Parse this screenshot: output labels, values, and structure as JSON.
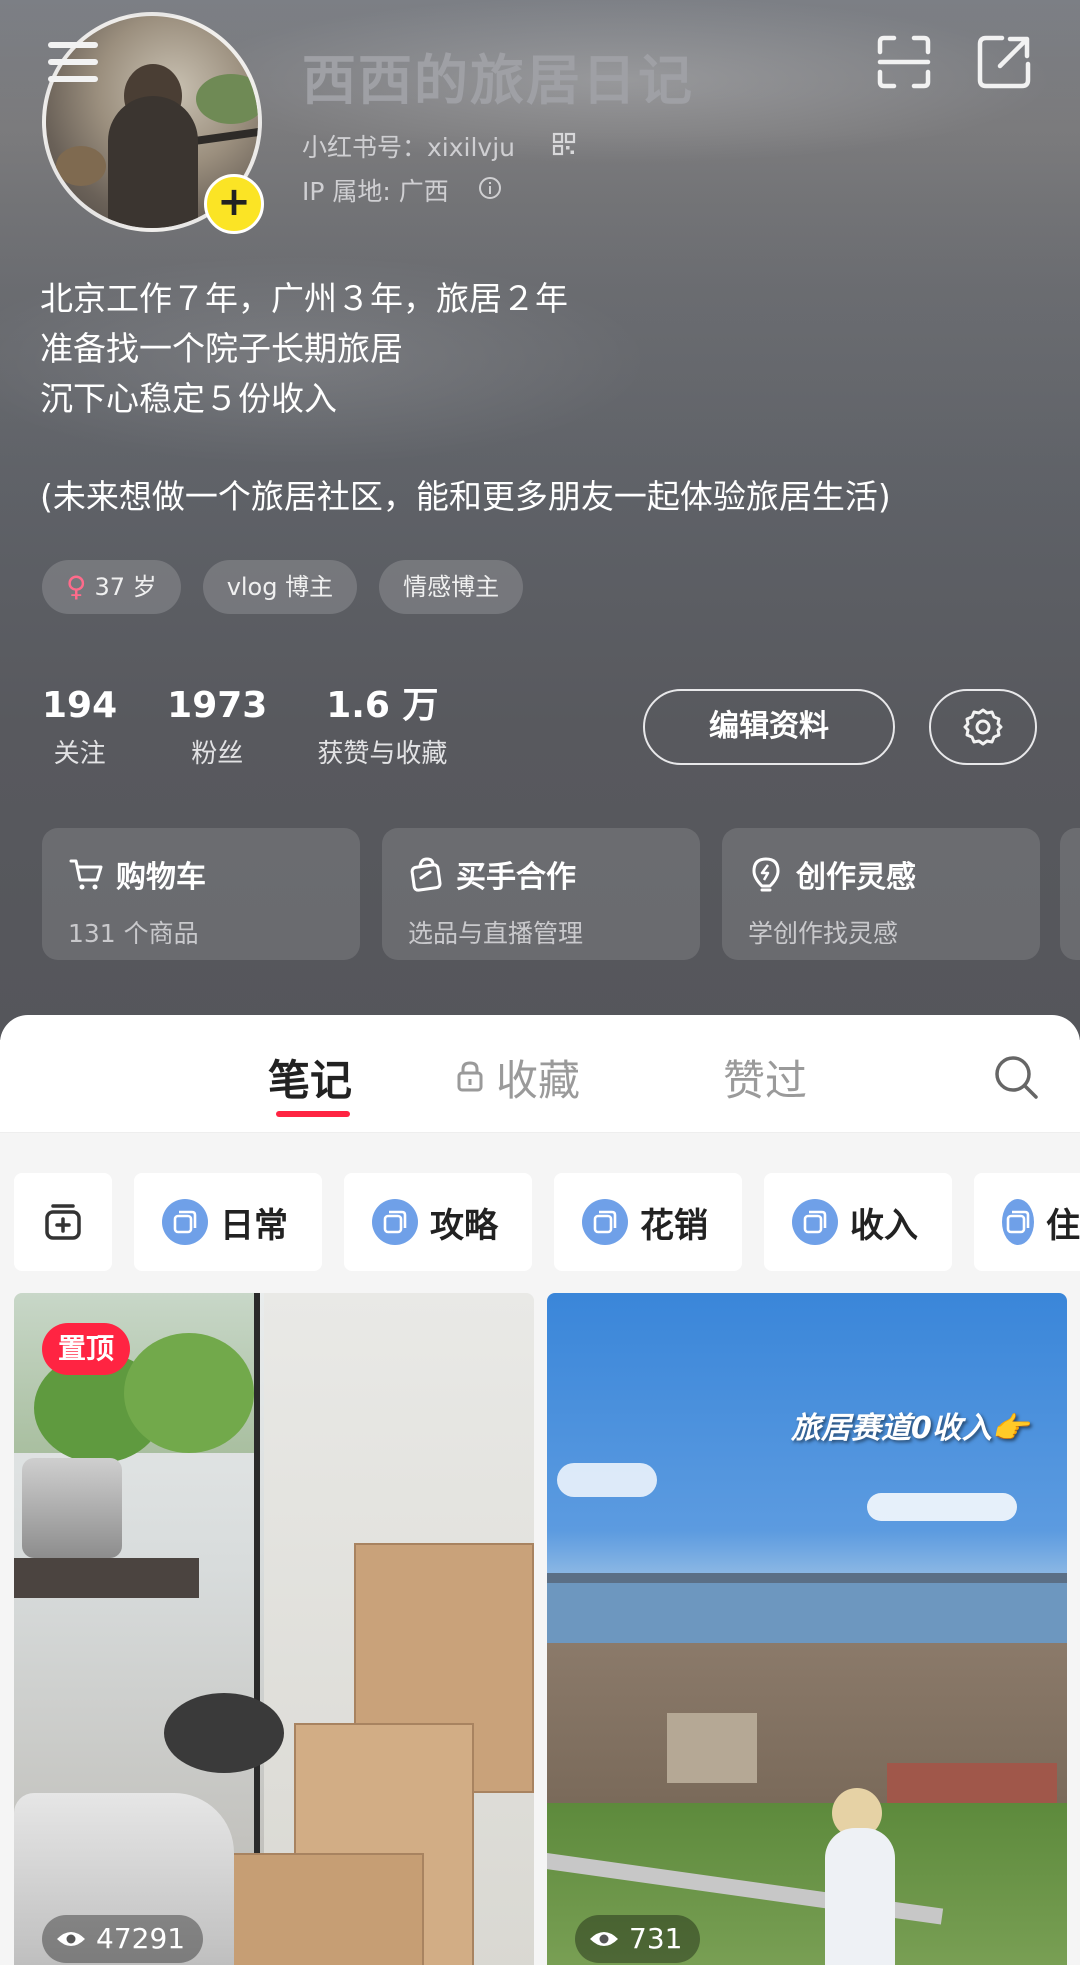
{
  "profile": {
    "nickname": "西西的旅居日记",
    "red_id": "小红书号：xixilvju",
    "ip": "IP 属地: 广西",
    "bio": [
      "北京工作７年，广州３年，旅居２年",
      "准备找一个院子长期旅居",
      "沉下心稳定５份收入",
      "(未来想做一个旅居社区，能和更多朋友一起体验旅居生活)"
    ],
    "tags": [
      {
        "icon": "female-icon",
        "label": "37 岁"
      },
      {
        "label": "vlog 博主"
      },
      {
        "label": "情感博主"
      }
    ]
  },
  "stats": [
    {
      "value": "194",
      "label": "关注"
    },
    {
      "value": "1973",
      "label": "粉丝"
    },
    {
      "value": "1.6 万",
      "label": "获赞与收藏"
    }
  ],
  "actions": {
    "edit_label": "编辑资料"
  },
  "cards": [
    {
      "icon": "cart-icon",
      "title": "购物车",
      "subtitle": "131 个商品"
    },
    {
      "icon": "bag-icon",
      "title": "买手合作",
      "subtitle": "选品与直播管理"
    },
    {
      "icon": "bulb-icon",
      "title": "创作灵感",
      "subtitle": "学创作找灵感"
    }
  ],
  "tabs": [
    {
      "label": "笔记",
      "active": true
    },
    {
      "label": "收藏",
      "locked": true
    },
    {
      "label": "赞过"
    }
  ],
  "filters": [
    "日常",
    "攻略",
    "花销",
    "收入",
    "住"
  ],
  "posts": [
    {
      "pinned_label": "置顶",
      "views": "47291"
    },
    {
      "overlay": "旅居赛道0收入👉",
      "views": "731"
    }
  ],
  "colors": {
    "accent": "#ff2442",
    "avatar_badge": "#fbe425",
    "filter_icon": "#6fa0e8"
  }
}
